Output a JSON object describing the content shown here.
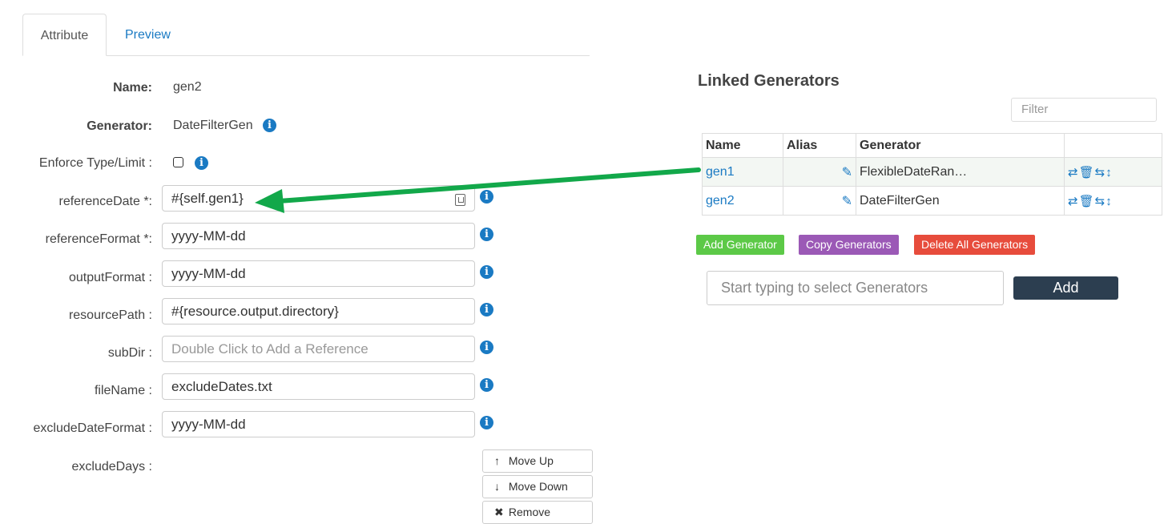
{
  "tabs": {
    "attribute": "Attribute",
    "preview": "Preview"
  },
  "form": {
    "name_label": "Name:",
    "name_value": "gen2",
    "generator_label": "Generator:",
    "generator_value": "DateFilterGen",
    "enforce_label": "Enforce Type/Limit :",
    "fields": [
      {
        "label": "referenceDate *:",
        "value": "#{self.gen1}"
      },
      {
        "label": "referenceFormat *:",
        "value": "yyyy-MM-dd"
      },
      {
        "label": "outputFormat :",
        "value": "yyyy-MM-dd"
      },
      {
        "label": "resourcePath :",
        "value": "#{resource.output.directory}"
      },
      {
        "label": "subDir :",
        "placeholder": "Double Click to Add a Reference"
      },
      {
        "label": "fileName :",
        "value": "excludeDates.txt"
      },
      {
        "label": "excludeDateFormat :",
        "value": "yyyy-MM-dd"
      }
    ],
    "exclude_days_label": "excludeDays :",
    "move_up": "Move Up",
    "move_down": "Move Down",
    "remove": "Remove"
  },
  "linked": {
    "title": "Linked Generators",
    "filter_placeholder": "Filter",
    "columns": [
      "Name",
      "Alias",
      "Generator",
      ""
    ],
    "rows": [
      {
        "name": "gen1",
        "alias": "",
        "generator": "FlexibleDateRan…"
      },
      {
        "name": "gen2",
        "alias": "",
        "generator": "DateFilterGen"
      }
    ],
    "add_generator": "Add Generator",
    "copy_generators": "Copy Generators",
    "delete_all": "Delete All Generators",
    "select_placeholder": "Start typing to select Generators",
    "add": "Add"
  },
  "colors": {
    "accent": "#1a7ac3",
    "arrow": "#12a84a",
    "green": "#5cc947",
    "purple": "#9b59b6",
    "red": "#e74c3c",
    "dark": "#2c3e50"
  }
}
